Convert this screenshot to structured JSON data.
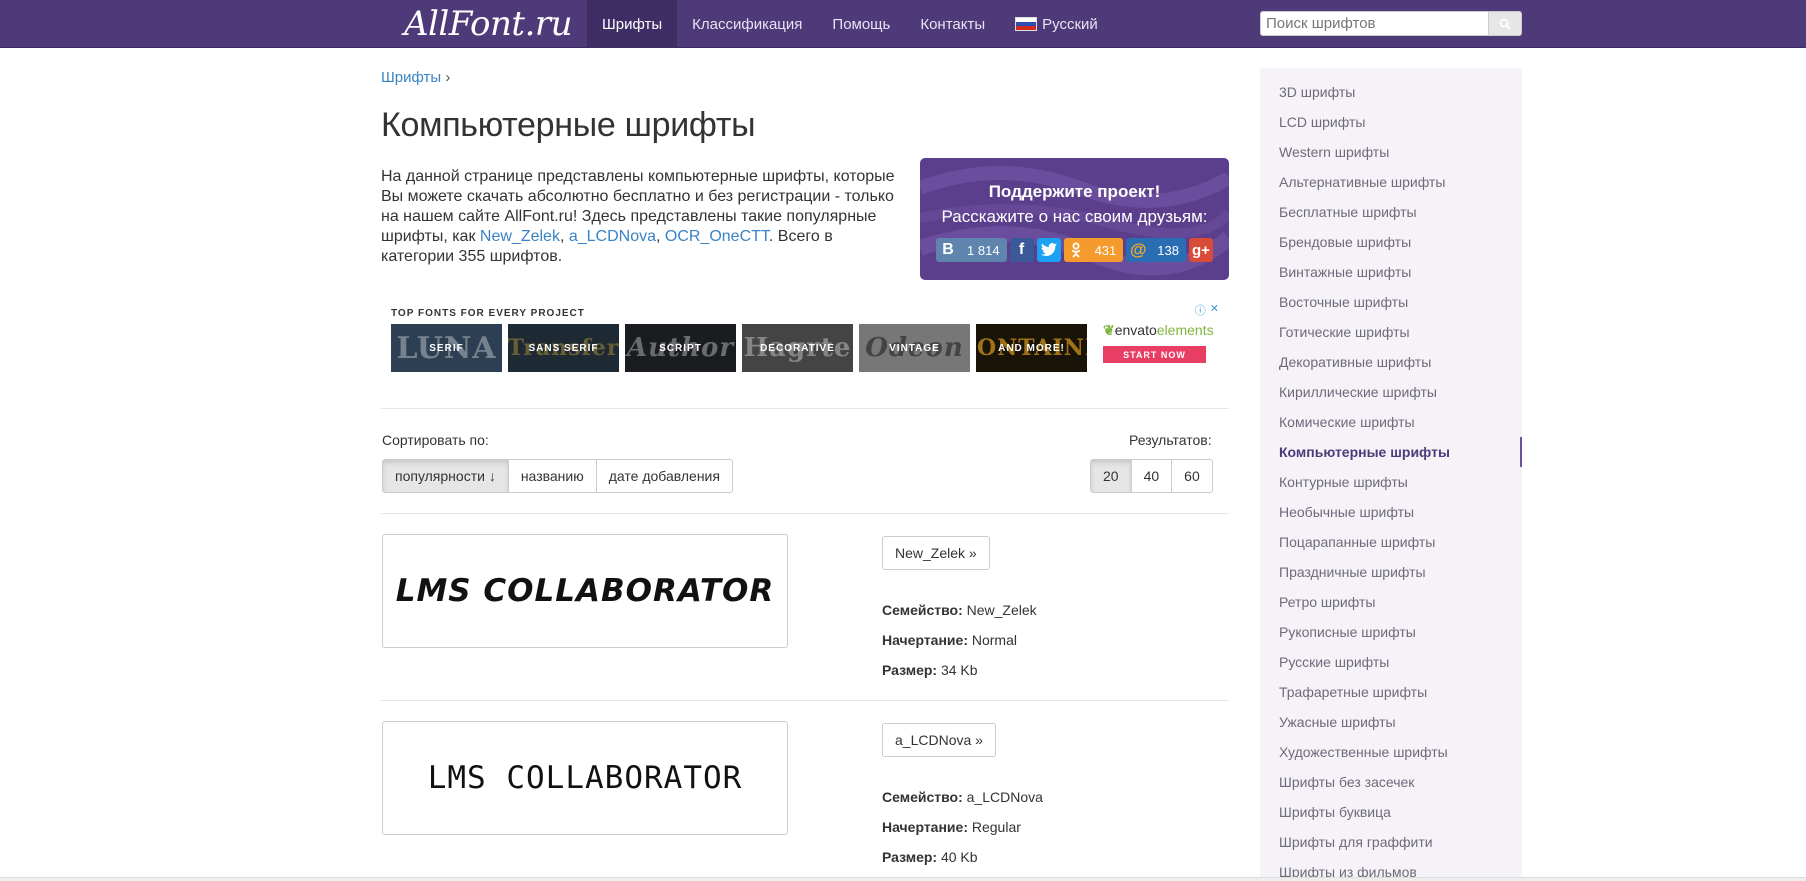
{
  "header": {
    "logo": "AllFont.ru",
    "nav": [
      {
        "label": "Шрифты",
        "active": true
      },
      {
        "label": "Классификация",
        "active": false
      },
      {
        "label": "Помощь",
        "active": false
      },
      {
        "label": "Контакты",
        "active": false
      }
    ],
    "language": "Русский",
    "search_placeholder": "Поиск шрифтов",
    "accent_color": "#4e3a79"
  },
  "breadcrumb": {
    "link": "Шрифты",
    "separator": "›"
  },
  "page_title": "Компьютерные шрифты",
  "intro": {
    "text_before": "На данной странице представлены компьютерные шрифты, которые Вы можете скачать абсолютно бесплатно и без регистрации - только на нашем сайте AllFont.ru! Здесь представлены такие популярные шрифты, как ",
    "link1": "New_Zelek",
    "sep1": ", ",
    "link2": "a_LCDNova",
    "sep2": ", ",
    "link3": "OCR_OneCTT",
    "text_after": ". Всего в категории 355 шрифтов."
  },
  "support": {
    "title": "Поддержите проект!",
    "subtitle": "Расскажите о нас своим друзьям:",
    "shares": [
      {
        "icon": "vk-icon",
        "glyph": "В",
        "count": "1 814",
        "color": "#5f84ad"
      },
      {
        "icon": "facebook-icon",
        "glyph": "f",
        "count": "",
        "color": "#3b5998"
      },
      {
        "icon": "twitter-icon",
        "glyph": "🐦",
        "count": "",
        "color": "#1da1f2"
      },
      {
        "icon": "odnoklassniki-icon",
        "glyph": "ок",
        "count": "431",
        "color": "#f59a2c"
      },
      {
        "icon": "mailru-icon",
        "glyph": "@",
        "count": "138",
        "color": "#2a6db3"
      },
      {
        "icon": "googleplus-icon",
        "glyph": "g+",
        "count": "",
        "color": "#d84b37"
      }
    ]
  },
  "ad": {
    "heading": "TOP FONTS FOR EVERY PROJECT",
    "tiles": [
      {
        "label": "SERIF",
        "bg_text": "LUNA",
        "color": "#2d3f52"
      },
      {
        "label": "SANS SERIF",
        "bg_text": "Transfer",
        "color": "#1e2a33"
      },
      {
        "label": "SCRIPT",
        "bg_text": "Author",
        "color": "#1a1c20"
      },
      {
        "label": "DECORATIVE",
        "bg_text": "Hagrte",
        "color": "#444"
      },
      {
        "label": "VINTAGE",
        "bg_text": "Odeon",
        "color": "#777"
      },
      {
        "label": "AND MORE!",
        "bg_text": "FONTAINE",
        "color": "#1a1408"
      }
    ],
    "brand_prefix": "envato",
    "brand_suffix": "elements",
    "cta": "START NOW"
  },
  "sort": {
    "label": "Сортировать по:",
    "options": [
      {
        "label": "популярности ↓",
        "active": true
      },
      {
        "label": "названию",
        "active": false
      },
      {
        "label": "дате добавления",
        "active": false
      }
    ]
  },
  "results": {
    "label": "Результатов:",
    "options": [
      {
        "label": "20",
        "active": true
      },
      {
        "label": "40",
        "active": false
      },
      {
        "label": "60",
        "active": false
      }
    ]
  },
  "fonts": [
    {
      "sample": "LMS COLLABORATOR",
      "button": "New_Zelek »",
      "family_label": "Семейство:",
      "family": "New_Zelek",
      "style_label": "Начертание:",
      "style": "Normal",
      "size_label": "Размер:",
      "size": "34 Kb"
    },
    {
      "sample": "LMS COLLABORATOR",
      "button": "a_LCDNova »",
      "family_label": "Семейство:",
      "family": "a_LCDNova",
      "style_label": "Начертание:",
      "style": "Regular",
      "size_label": "Размер:",
      "size": "40 Kb"
    }
  ],
  "sidebar": {
    "items": [
      {
        "label": "3D шрифты",
        "active": false
      },
      {
        "label": "LCD шрифты",
        "active": false
      },
      {
        "label": "Western шрифты",
        "active": false
      },
      {
        "label": "Альтернативные шрифты",
        "active": false
      },
      {
        "label": "Бесплатные шрифты",
        "active": false
      },
      {
        "label": "Брендовые шрифты",
        "active": false
      },
      {
        "label": "Винтажные шрифты",
        "active": false
      },
      {
        "label": "Восточные шрифты",
        "active": false
      },
      {
        "label": "Готические шрифты",
        "active": false
      },
      {
        "label": "Декоративные шрифты",
        "active": false
      },
      {
        "label": "Кириллические шрифты",
        "active": false
      },
      {
        "label": "Комические шрифты",
        "active": false
      },
      {
        "label": "Компьютерные шрифты",
        "active": true
      },
      {
        "label": "Контурные шрифты",
        "active": false
      },
      {
        "label": "Необычные шрифты",
        "active": false
      },
      {
        "label": "Поцарапанные шрифты",
        "active": false
      },
      {
        "label": "Праздничные шрифты",
        "active": false
      },
      {
        "label": "Ретро шрифты",
        "active": false
      },
      {
        "label": "Рукописные шрифты",
        "active": false
      },
      {
        "label": "Русские шрифты",
        "active": false
      },
      {
        "label": "Трафаретные шрифты",
        "active": false
      },
      {
        "label": "Ужасные шрифты",
        "active": false
      },
      {
        "label": "Художественные шрифты",
        "active": false
      },
      {
        "label": "Шрифты без засечек",
        "active": false
      },
      {
        "label": "Шрифты буквица",
        "active": false
      },
      {
        "label": "Шрифты для граффити",
        "active": false
      },
      {
        "label": "Шрифты из фильмов",
        "active": false
      }
    ]
  }
}
